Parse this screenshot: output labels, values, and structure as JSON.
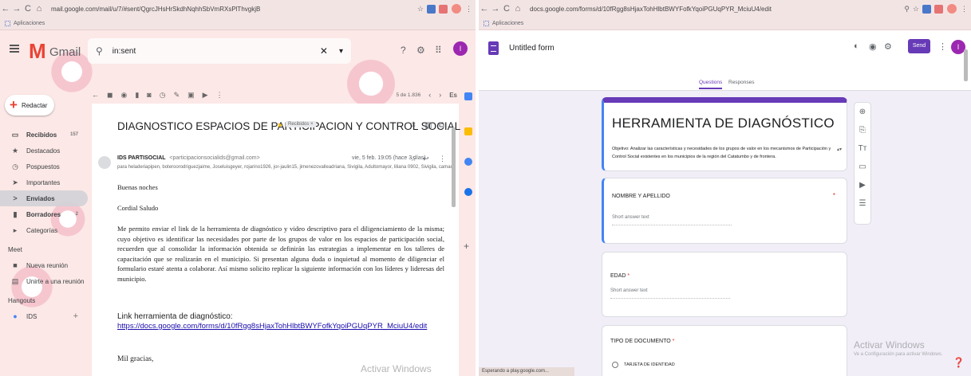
{
  "gmail_window": {
    "url": "mail.google.com/mail/u/7/#sent/QgrcJHsHrSkdhNqhhSbVmRXsPlThvgkjB",
    "bookmarks_label": "Aplicaciones",
    "app_name": "Gmail",
    "search_value": "in:sent",
    "compose_label": "Redactar",
    "nav": [
      {
        "label": "Recibidos",
        "count": "157",
        "icon": "inbox-icon",
        "bold": true
      },
      {
        "label": "Destacados",
        "count": "",
        "icon": "star-icon"
      },
      {
        "label": "Pospuestos",
        "count": "",
        "icon": "clock-icon"
      },
      {
        "label": "Importantes",
        "count": "",
        "icon": "important-icon"
      },
      {
        "label": "Enviados",
        "count": "",
        "icon": "send-icon",
        "bold": true,
        "active": true
      },
      {
        "label": "Borradores",
        "count": "2",
        "icon": "draft-icon",
        "bold": true
      },
      {
        "label": "Categorías",
        "count": "",
        "icon": "label-icon"
      }
    ],
    "meet_label": "Meet",
    "meet_items": [
      "Nueva reunión",
      "Unirte a una reunión"
    ],
    "hangouts_label": "Hangouts",
    "hangouts_user": "IDS",
    "pagination": "5 de 1.836",
    "lang": "Es",
    "subject": "DIAGNOSTICO ESPACIOS DE PARTICIPACION Y CONTROL SOCIAL",
    "subject_label": "Recibidos ×",
    "sender_name": "IDS PARTISOCIAL",
    "sender_email": "<participacionsocialids@gmail.com>",
    "date": "vie, 5 feb. 19:05 (hace 3 días)",
    "recipients": "para heladeriapipen, boteroorodriguezjaime, Joseluisgeyer, rojarino1926, jor-jaulin15, jimenezovalleadriana, Sivigila, Adultomayor, liliana 0902, Sivigila, camacti",
    "greeting": "Buenas noches",
    "salutation": "Cordial Saludo",
    "body": "Me permito enviar el  link de la herramienta de diagnóstico y video descriptivo para el diligenciamiento de la misma; cuyo objetivo es identificar  las necesidades por parte de los grupos de valor en los espacios de participación social, recuerden que al consolidar la información obtenida se definirán las estrategias a implementar en los talleres de capacitación que se realizarán en el municipio. Si presentan alguna duda o inquietud al momento de diligenciar el formulario estaré atenta a colaborar. Así mismo solicito replicar la siguiente información con los líderes y lideresas del municipio.",
    "link_label": "Link herramienta de diagnóstico:",
    "link_url": "https://docs.google.com/forms/d/10fRgg8sHjaxTohHlbtBWYFofkYqoiPGUqPYR_MciuU4/edit",
    "closing": "Mil gracias,",
    "watermark": "Activar Windows"
  },
  "forms_window": {
    "url": "docs.google.com/forms/d/10fRgg8sHjaxTohHlbtBWYFofkYqoiPGUqPYR_MciuU4/edit",
    "bookmarks_label": "Aplicaciones",
    "doc_title": "Untitled form",
    "send_label": "Send",
    "tabs": [
      "Questions",
      "Responses"
    ],
    "form_title": "HERRAMIENTA DE DIAGNÓSTICO",
    "form_description": "Objetivo: Analizar las características y necesidades de los grupos de valor en los mecanismos de Participación y Control Social existentes en los municipios de la región del Catatumbo y de frontera.",
    "questions": [
      {
        "title": "NOMBRE Y APELLIDO",
        "hint": "Short answer text"
      },
      {
        "title": "EDAD",
        "hint": "Short answer text"
      },
      {
        "title": "TIPO DE DOCUMENTO",
        "option": "TARJETA DE IDENTIDAD"
      }
    ],
    "watermark_title": "Activar Windows",
    "watermark_sub": "Ve a Configuración para activar Windows.",
    "status": "Esperando a play.google.com..."
  }
}
